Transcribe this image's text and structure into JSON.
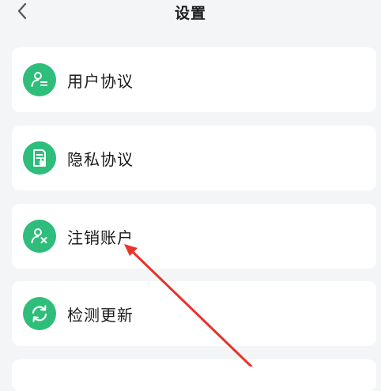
{
  "header": {
    "title": "设置"
  },
  "menu": [
    {
      "label": "用户协议",
      "icon": "user-agreement-icon"
    },
    {
      "label": "隐私协议",
      "icon": "privacy-document-icon"
    },
    {
      "label": "注销账户",
      "icon": "delete-account-icon"
    },
    {
      "label": "检测更新",
      "icon": "check-update-icon"
    }
  ],
  "colors": {
    "accent": "#2ebd7b",
    "background": "#f4f5f7",
    "annotation_arrow": "#e8322a"
  }
}
